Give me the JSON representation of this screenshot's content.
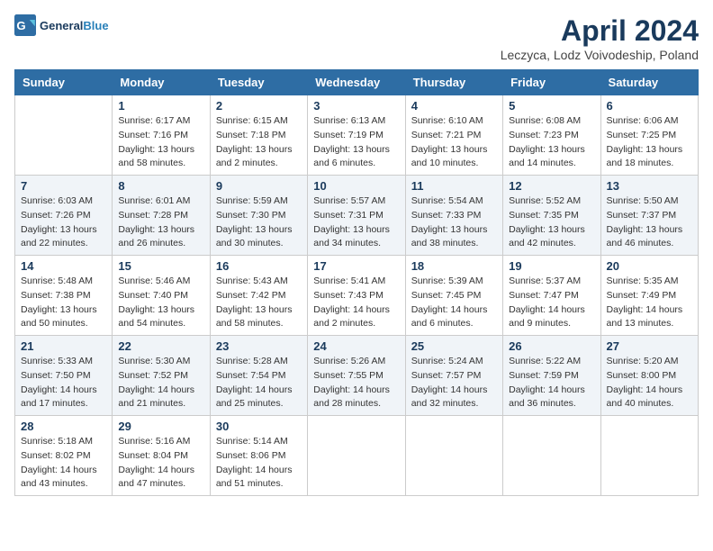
{
  "header": {
    "logo_general": "General",
    "logo_blue": "Blue",
    "month_title": "April 2024",
    "subtitle": "Leczyca, Lodz Voivodeship, Poland"
  },
  "days_of_week": [
    "Sunday",
    "Monday",
    "Tuesday",
    "Wednesday",
    "Thursday",
    "Friday",
    "Saturday"
  ],
  "weeks": [
    [
      {
        "day": "",
        "sunrise": "",
        "sunset": "",
        "daylight": ""
      },
      {
        "day": "1",
        "sunrise": "Sunrise: 6:17 AM",
        "sunset": "Sunset: 7:16 PM",
        "daylight": "Daylight: 13 hours and 58 minutes."
      },
      {
        "day": "2",
        "sunrise": "Sunrise: 6:15 AM",
        "sunset": "Sunset: 7:18 PM",
        "daylight": "Daylight: 13 hours and 2 minutes."
      },
      {
        "day": "3",
        "sunrise": "Sunrise: 6:13 AM",
        "sunset": "Sunset: 7:19 PM",
        "daylight": "Daylight: 13 hours and 6 minutes."
      },
      {
        "day": "4",
        "sunrise": "Sunrise: 6:10 AM",
        "sunset": "Sunset: 7:21 PM",
        "daylight": "Daylight: 13 hours and 10 minutes."
      },
      {
        "day": "5",
        "sunrise": "Sunrise: 6:08 AM",
        "sunset": "Sunset: 7:23 PM",
        "daylight": "Daylight: 13 hours and 14 minutes."
      },
      {
        "day": "6",
        "sunrise": "Sunrise: 6:06 AM",
        "sunset": "Sunset: 7:25 PM",
        "daylight": "Daylight: 13 hours and 18 minutes."
      }
    ],
    [
      {
        "day": "7",
        "sunrise": "Sunrise: 6:03 AM",
        "sunset": "Sunset: 7:26 PM",
        "daylight": "Daylight: 13 hours and 22 minutes."
      },
      {
        "day": "8",
        "sunrise": "Sunrise: 6:01 AM",
        "sunset": "Sunset: 7:28 PM",
        "daylight": "Daylight: 13 hours and 26 minutes."
      },
      {
        "day": "9",
        "sunrise": "Sunrise: 5:59 AM",
        "sunset": "Sunset: 7:30 PM",
        "daylight": "Daylight: 13 hours and 30 minutes."
      },
      {
        "day": "10",
        "sunrise": "Sunrise: 5:57 AM",
        "sunset": "Sunset: 7:31 PM",
        "daylight": "Daylight: 13 hours and 34 minutes."
      },
      {
        "day": "11",
        "sunrise": "Sunrise: 5:54 AM",
        "sunset": "Sunset: 7:33 PM",
        "daylight": "Daylight: 13 hours and 38 minutes."
      },
      {
        "day": "12",
        "sunrise": "Sunrise: 5:52 AM",
        "sunset": "Sunset: 7:35 PM",
        "daylight": "Daylight: 13 hours and 42 minutes."
      },
      {
        "day": "13",
        "sunrise": "Sunrise: 5:50 AM",
        "sunset": "Sunset: 7:37 PM",
        "daylight": "Daylight: 13 hours and 46 minutes."
      }
    ],
    [
      {
        "day": "14",
        "sunrise": "Sunrise: 5:48 AM",
        "sunset": "Sunset: 7:38 PM",
        "daylight": "Daylight: 13 hours and 50 minutes."
      },
      {
        "day": "15",
        "sunrise": "Sunrise: 5:46 AM",
        "sunset": "Sunset: 7:40 PM",
        "daylight": "Daylight: 13 hours and 54 minutes."
      },
      {
        "day": "16",
        "sunrise": "Sunrise: 5:43 AM",
        "sunset": "Sunset: 7:42 PM",
        "daylight": "Daylight: 13 hours and 58 minutes."
      },
      {
        "day": "17",
        "sunrise": "Sunrise: 5:41 AM",
        "sunset": "Sunset: 7:43 PM",
        "daylight": "Daylight: 14 hours and 2 minutes."
      },
      {
        "day": "18",
        "sunrise": "Sunrise: 5:39 AM",
        "sunset": "Sunset: 7:45 PM",
        "daylight": "Daylight: 14 hours and 6 minutes."
      },
      {
        "day": "19",
        "sunrise": "Sunrise: 5:37 AM",
        "sunset": "Sunset: 7:47 PM",
        "daylight": "Daylight: 14 hours and 9 minutes."
      },
      {
        "day": "20",
        "sunrise": "Sunrise: 5:35 AM",
        "sunset": "Sunset: 7:49 PM",
        "daylight": "Daylight: 14 hours and 13 minutes."
      }
    ],
    [
      {
        "day": "21",
        "sunrise": "Sunrise: 5:33 AM",
        "sunset": "Sunset: 7:50 PM",
        "daylight": "Daylight: 14 hours and 17 minutes."
      },
      {
        "day": "22",
        "sunrise": "Sunrise: 5:30 AM",
        "sunset": "Sunset: 7:52 PM",
        "daylight": "Daylight: 14 hours and 21 minutes."
      },
      {
        "day": "23",
        "sunrise": "Sunrise: 5:28 AM",
        "sunset": "Sunset: 7:54 PM",
        "daylight": "Daylight: 14 hours and 25 minutes."
      },
      {
        "day": "24",
        "sunrise": "Sunrise: 5:26 AM",
        "sunset": "Sunset: 7:55 PM",
        "daylight": "Daylight: 14 hours and 28 minutes."
      },
      {
        "day": "25",
        "sunrise": "Sunrise: 5:24 AM",
        "sunset": "Sunset: 7:57 PM",
        "daylight": "Daylight: 14 hours and 32 minutes."
      },
      {
        "day": "26",
        "sunrise": "Sunrise: 5:22 AM",
        "sunset": "Sunset: 7:59 PM",
        "daylight": "Daylight: 14 hours and 36 minutes."
      },
      {
        "day": "27",
        "sunrise": "Sunrise: 5:20 AM",
        "sunset": "Sunset: 8:00 PM",
        "daylight": "Daylight: 14 hours and 40 minutes."
      }
    ],
    [
      {
        "day": "28",
        "sunrise": "Sunrise: 5:18 AM",
        "sunset": "Sunset: 8:02 PM",
        "daylight": "Daylight: 14 hours and 43 minutes."
      },
      {
        "day": "29",
        "sunrise": "Sunrise: 5:16 AM",
        "sunset": "Sunset: 8:04 PM",
        "daylight": "Daylight: 14 hours and 47 minutes."
      },
      {
        "day": "30",
        "sunrise": "Sunrise: 5:14 AM",
        "sunset": "Sunset: 8:06 PM",
        "daylight": "Daylight: 14 hours and 51 minutes."
      },
      {
        "day": "",
        "sunrise": "",
        "sunset": "",
        "daylight": ""
      },
      {
        "day": "",
        "sunrise": "",
        "sunset": "",
        "daylight": ""
      },
      {
        "day": "",
        "sunrise": "",
        "sunset": "",
        "daylight": ""
      },
      {
        "day": "",
        "sunrise": "",
        "sunset": "",
        "daylight": ""
      }
    ]
  ]
}
